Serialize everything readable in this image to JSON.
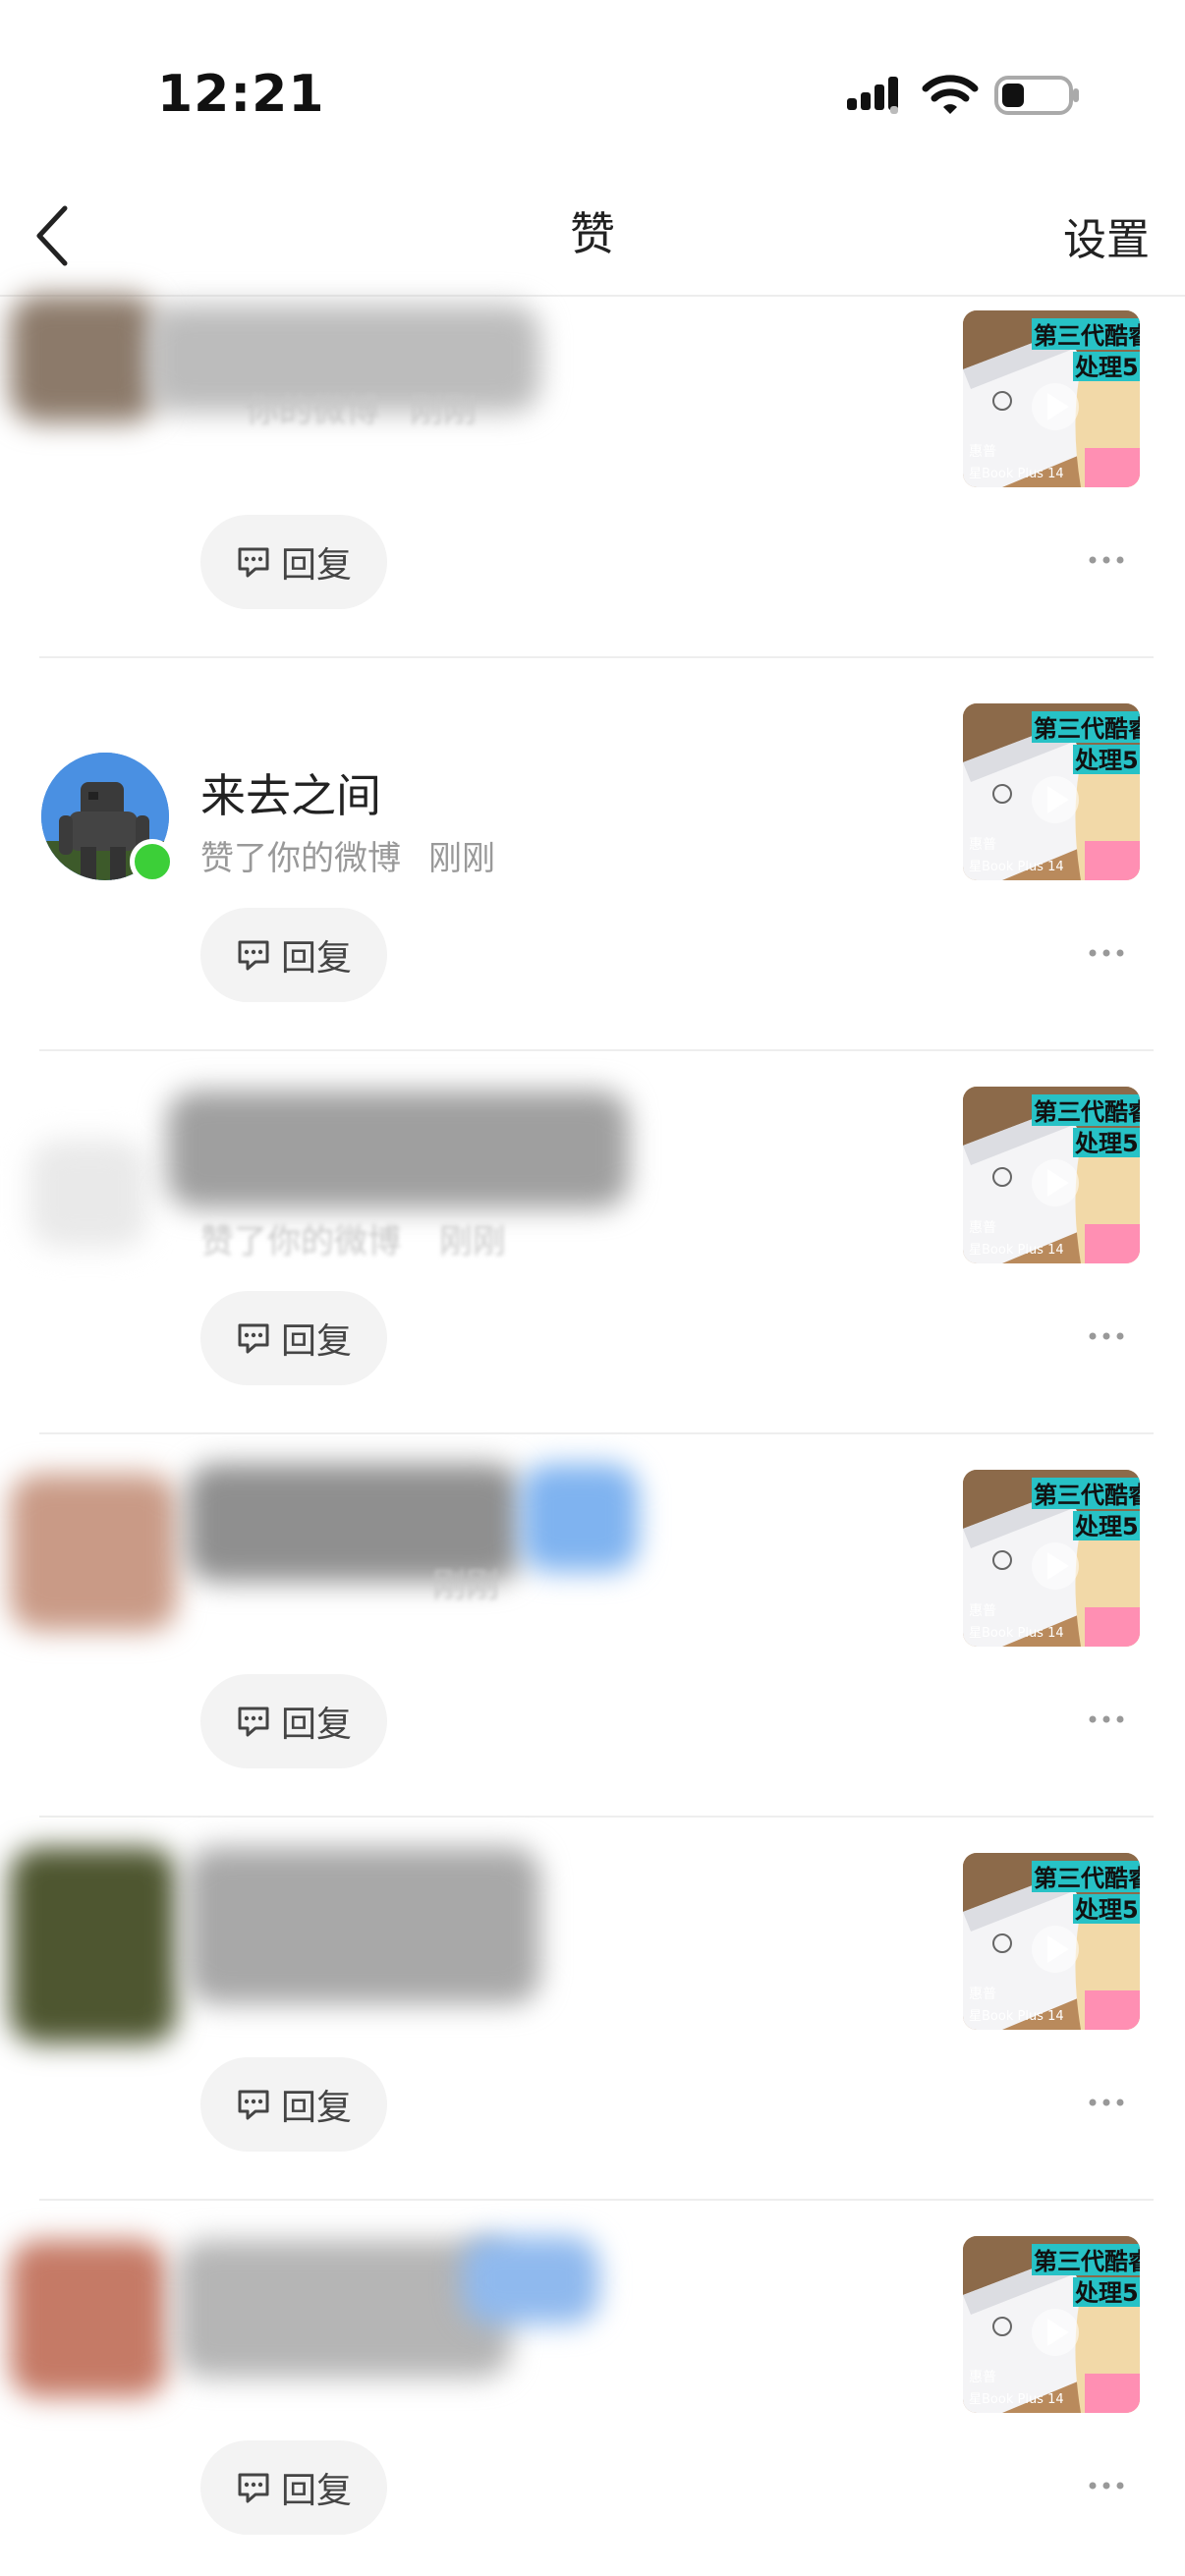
{
  "status_bar": {
    "time": "12:21"
  },
  "nav": {
    "title": "赞",
    "settings": "设置"
  },
  "list": {
    "items": [
      {
        "name": "",
        "action": "你的微博",
        "time": "刚刚",
        "reply": "回复"
      },
      {
        "name": "来去之间",
        "action": "赞了你的微博",
        "time": "刚刚",
        "reply": "回复"
      },
      {
        "name": "",
        "action": "赞了你的微博",
        "time": "刚刚",
        "reply": "回复"
      },
      {
        "name": "",
        "action": "",
        "time": "刚刚",
        "reply": "回复"
      },
      {
        "name": "",
        "action": "",
        "time": "",
        "reply": "回复"
      },
      {
        "name": "",
        "action": "",
        "time": "",
        "reply": "回复"
      }
    ]
  },
  "thumbnail": {
    "headline_1": "第三代酷睿",
    "headline_2": "处理5",
    "brand": "惠普",
    "model": "星Book Plus 14",
    "logo": "hp"
  },
  "colors": {
    "online": "#3ccf38",
    "reply_bg": "#f3f3f3",
    "thumb_teal": "#27c2c6"
  },
  "icons": [
    "back-arrow-icon",
    "signal-icon",
    "wifi-icon",
    "battery-icon",
    "comment-icon",
    "more-icon",
    "play-icon"
  ]
}
